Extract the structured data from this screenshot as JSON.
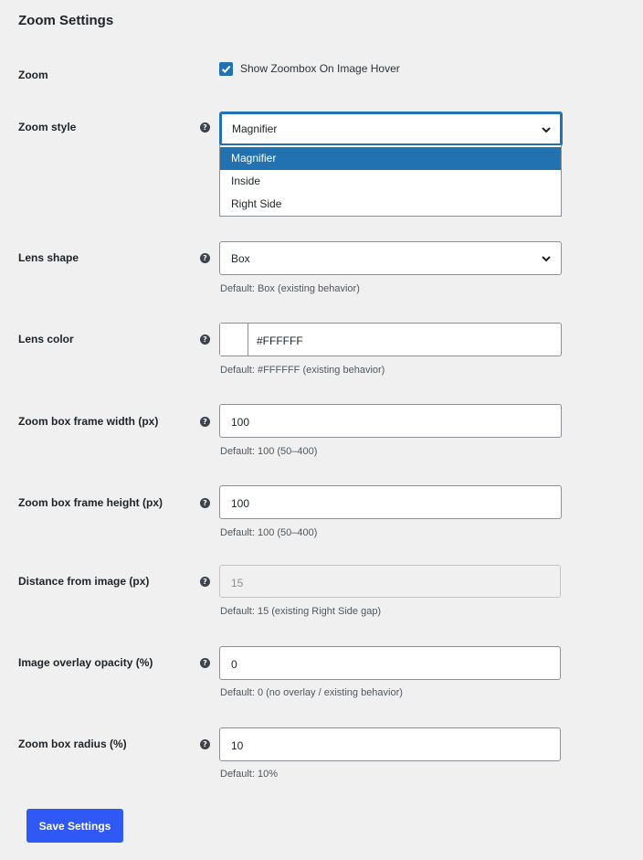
{
  "section": {
    "title": "Zoom Settings"
  },
  "zoom": {
    "label": "Zoom",
    "checkbox_label": "Show Zoombox On Image Hover",
    "checked": true
  },
  "zoom_style": {
    "label": "Zoom style",
    "selected": "Magnifier",
    "options": [
      "Magnifier",
      "Inside",
      "Right Side"
    ]
  },
  "lens_shape": {
    "label": "Lens shape",
    "selected": "Box",
    "hint": "Default: Box (existing behavior)"
  },
  "lens_color": {
    "label": "Lens color",
    "value": "#FFFFFF",
    "swatch_color": "#ffffff",
    "hint": "Default: #FFFFFF (existing behavior)"
  },
  "frame_width": {
    "label": "Zoom box frame width (px)",
    "value": "100",
    "hint": "Default: 100 (50–400)"
  },
  "frame_height": {
    "label": "Zoom box frame height (px)",
    "value": "100",
    "hint": "Default: 100 (50–400)"
  },
  "distance": {
    "label": "Distance from image (px)",
    "value": "15",
    "disabled": true,
    "hint": "Default: 15 (existing Right Side gap)"
  },
  "overlay_opacity": {
    "label": "Image overlay opacity (%)",
    "value": "0",
    "hint": "Default: 0 (no overlay / existing behavior)"
  },
  "box_radius": {
    "label": "Zoom box radius (%)",
    "value": "10",
    "hint": "Default: 10%"
  },
  "help_glyph": "?",
  "save_label": "Save Settings",
  "colors": {
    "accent": "#2271b1",
    "save_button": "#2f58f4",
    "background": "#f0f0f1"
  }
}
